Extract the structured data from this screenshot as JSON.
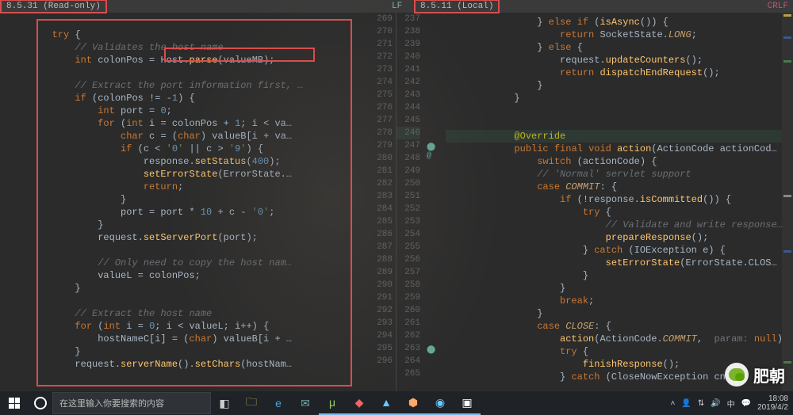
{
  "header": {
    "left_tab": "8.5.31 (Read-only)",
    "right_tab": "8.5.11 (Local)",
    "lf": "LF",
    "crlf": "CRLF"
  },
  "left": {
    "line_start": 269,
    "lines": [
      "",
      "        try {",
      "            // Validates the host name",
      "            int colonPos = Host.parse(valueMB);",
      "",
      "            // Extract the port information first, …",
      "            if (colonPos != -1) {",
      "                int port = 0;",
      "                for (int i = colonPos + 1; i < va…",
      "                    char c = (char) valueB[i + va…",
      "                    if (c < '0' || c > '9') {",
      "                        response.setStatus(400);",
      "                        setErrorState(ErrorState.…",
      "                        return;",
      "                    }",
      "                    port = port * 10 + c - '0';",
      "                }",
      "                request.setServerPort(port);",
      "",
      "                // Only need to copy the host nam…",
      "                valueL = colonPos;",
      "            }",
      "",
      "            // Extract the host name",
      "            for (int i = 0; i < valueL; i++) {",
      "                hostNameC[i] = (char) valueB[i + …",
      "            }",
      "            request.serverName().setChars(hostNam…"
    ]
  },
  "right": {
    "line_start": 237,
    "lines": [
      "                } else if (isAsync()) {",
      "                    return SocketState.LONG;",
      "                } else {",
      "                    request.updateCounters();",
      "                    return dispatchEndRequest();",
      "                }",
      "            }",
      "",
      "",
      "            @Override",
      "            public final void action(ActionCode actionCod…",
      "                switch (actionCode) {",
      "                // 'Normal' servlet support",
      "                case COMMIT: {",
      "                    if (!response.isCommitted()) {",
      "                        try {",
      "                            // Validate and write response…",
      "                            prepareResponse();",
      "                        } catch (IOException e) {",
      "                            setErrorState(ErrorState.CLOS…",
      "                        }",
      "                    }",
      "                    break;",
      "                }",
      "                case CLOSE: {",
      "                    action(ActionCode.COMMIT,  param: null)…",
      "                    try {",
      "                        finishResponse();",
      "                    } catch (CloseNowException cne…"
    ]
  },
  "taskbar": {
    "search_placeholder": "在这里输入你要搜索的内容",
    "time": "18:08",
    "date": "2019/4/2"
  },
  "overlay": {
    "wechat_name": "肥朝"
  },
  "highlight_boxes": {
    "top_left_tab": true,
    "top_right_tab": true,
    "left_code_block": true,
    "host_parse_call": true
  }
}
